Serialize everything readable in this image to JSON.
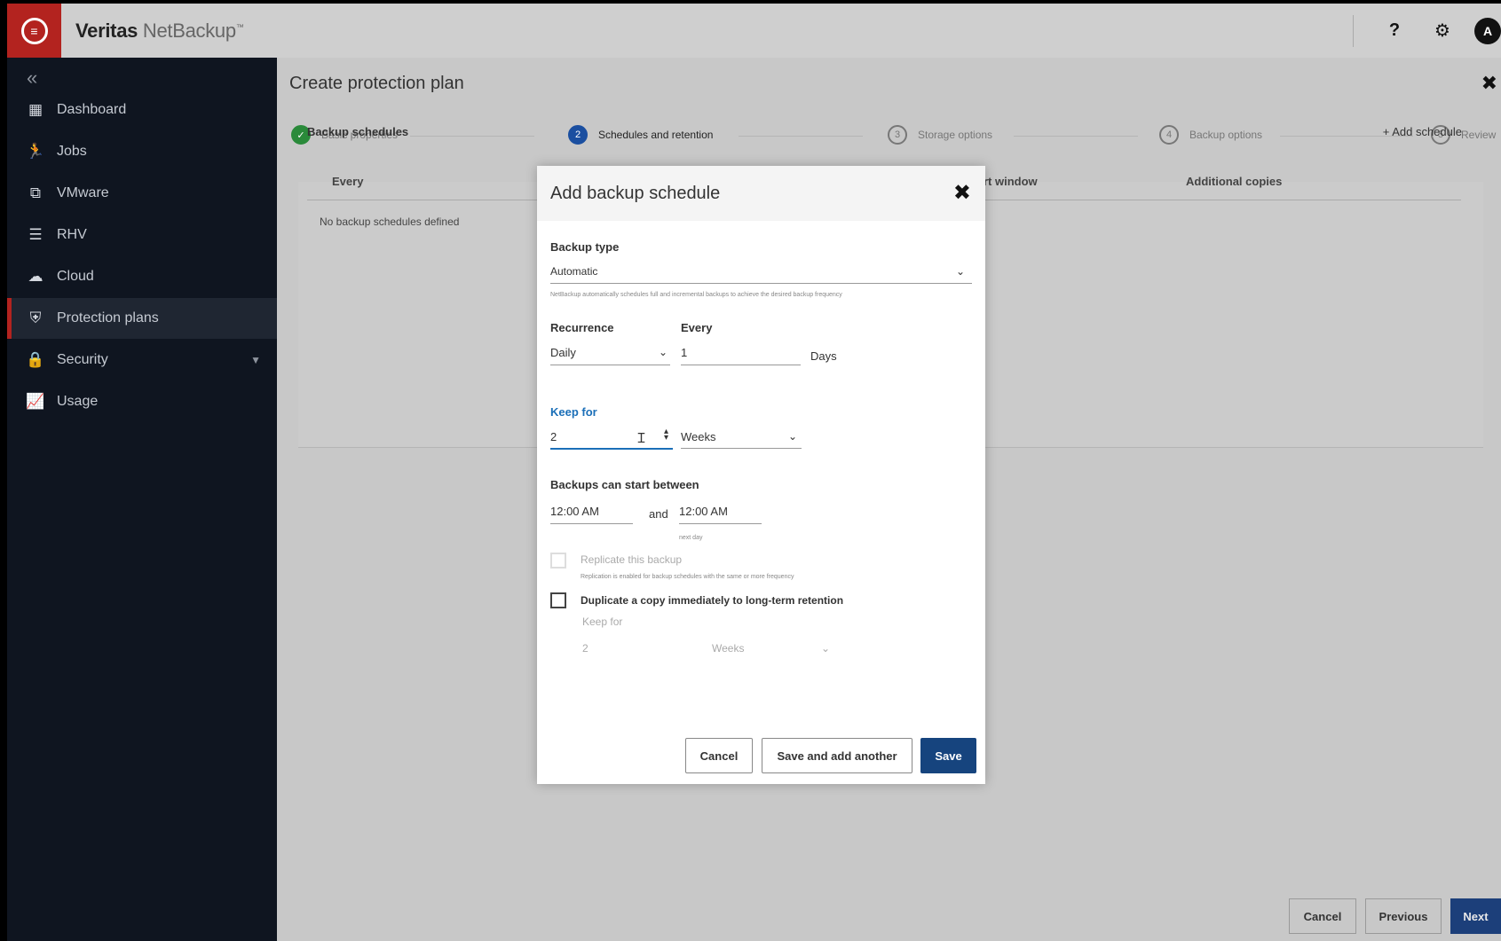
{
  "brand": {
    "name_bold": "Veritas",
    "name_light": "NetBackup",
    "tm": "™"
  },
  "topbar": {
    "help": "?",
    "settings": "⚙",
    "avatar": "A"
  },
  "sidebar": {
    "collapse": "«",
    "items": [
      {
        "label": "Dashboard",
        "icon": "dashboard-icon"
      },
      {
        "label": "Jobs",
        "icon": "jobs-icon"
      },
      {
        "label": "VMware",
        "icon": "vmware-icon"
      },
      {
        "label": "RHV",
        "icon": "rhv-icon"
      },
      {
        "label": "Cloud",
        "icon": "cloud-icon"
      },
      {
        "label": "Protection plans",
        "icon": "shield-icon"
      },
      {
        "label": "Security",
        "icon": "lock-icon"
      },
      {
        "label": "Usage",
        "icon": "chart-icon"
      }
    ]
  },
  "main": {
    "title": "Create protection plan",
    "close": "✖",
    "steps": [
      {
        "num": "✓",
        "label": "Basic properties"
      },
      {
        "num": "2",
        "label": "Schedules and retention"
      },
      {
        "num": "3",
        "label": "Storage options"
      },
      {
        "num": "4",
        "label": "Backup options"
      },
      {
        "num": "5",
        "label": "Review"
      }
    ],
    "schedules_title": "Backup schedules",
    "add_schedule": "+ Add schedule",
    "columns": [
      "Every",
      "rt window",
      "Additional copies"
    ],
    "empty": "No backup schedules defined",
    "footer": {
      "cancel": "Cancel",
      "previous": "Previous",
      "next": "Next"
    }
  },
  "modal": {
    "title": "Add backup schedule",
    "close": "✖",
    "backup_type_label": "Backup type",
    "backup_type_value": "Automatic",
    "backup_type_help": "NetBackup automatically schedules full and incremental backups to achieve the desired backup frequency",
    "recurrence_label": "Recurrence",
    "recurrence_value": "Daily",
    "every_label": "Every",
    "every_value": "1",
    "every_unit": "Days",
    "keep_label": "Keep for",
    "keep_value": "2",
    "keep_unit": "Weeks",
    "window_label": "Backups can start between",
    "window_start": "12:00 AM",
    "window_and": "and",
    "window_end": "12:00 AM",
    "window_end_note": "next day",
    "replicate_label": "Replicate this backup",
    "replicate_help": "Replication is enabled for backup schedules with the same or more frequency",
    "duplicate_label": "Duplicate a copy immediately to long-term retention",
    "dup_keep_label": "Keep for",
    "dup_keep_value": "2",
    "dup_keep_unit": "Weeks",
    "buttons": {
      "cancel": "Cancel",
      "save_add": "Save and add another",
      "save": "Save"
    }
  }
}
